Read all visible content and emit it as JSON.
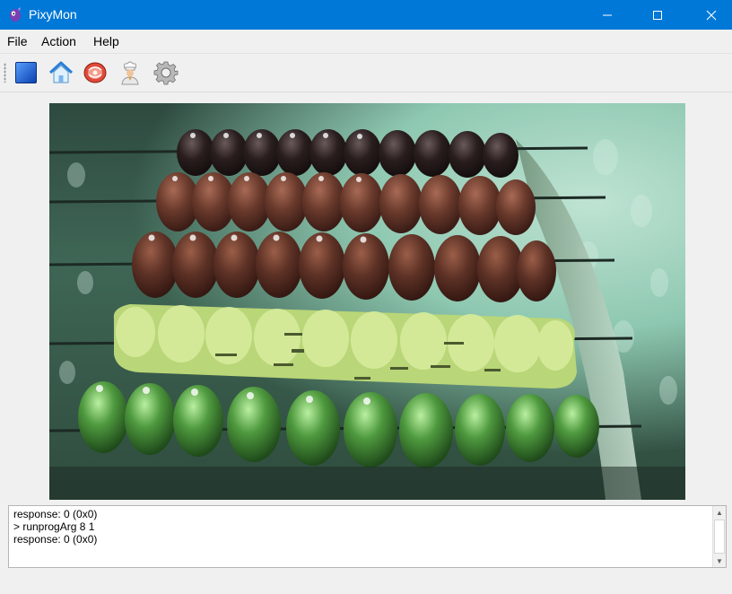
{
  "window": {
    "title": "PixyMon",
    "controls": {
      "minimize": "—",
      "maximize": "☐",
      "close": "✕"
    }
  },
  "menu": {
    "items": [
      "File",
      "Action",
      "Help"
    ]
  },
  "toolbar": {
    "buttons": [
      {
        "icon": "stop-square-icon"
      },
      {
        "icon": "home-icon"
      },
      {
        "icon": "raw-video-icon"
      },
      {
        "icon": "chef-icon"
      },
      {
        "icon": "gear-icon"
      }
    ]
  },
  "video": {
    "description_colors": {
      "bead_dark": "#3a2a28",
      "bead_brown": "#6b3a2e",
      "bead_lime": "#b9d678",
      "bead_green": "#4f9a3f"
    }
  },
  "console": {
    "lines": [
      "response: 0 (0x0)",
      "> runprogArg 8 1",
      "response: 0 (0x0)"
    ]
  },
  "colors": {
    "titlebar": "#0078d7",
    "window_bg": "#f0f0f0"
  }
}
